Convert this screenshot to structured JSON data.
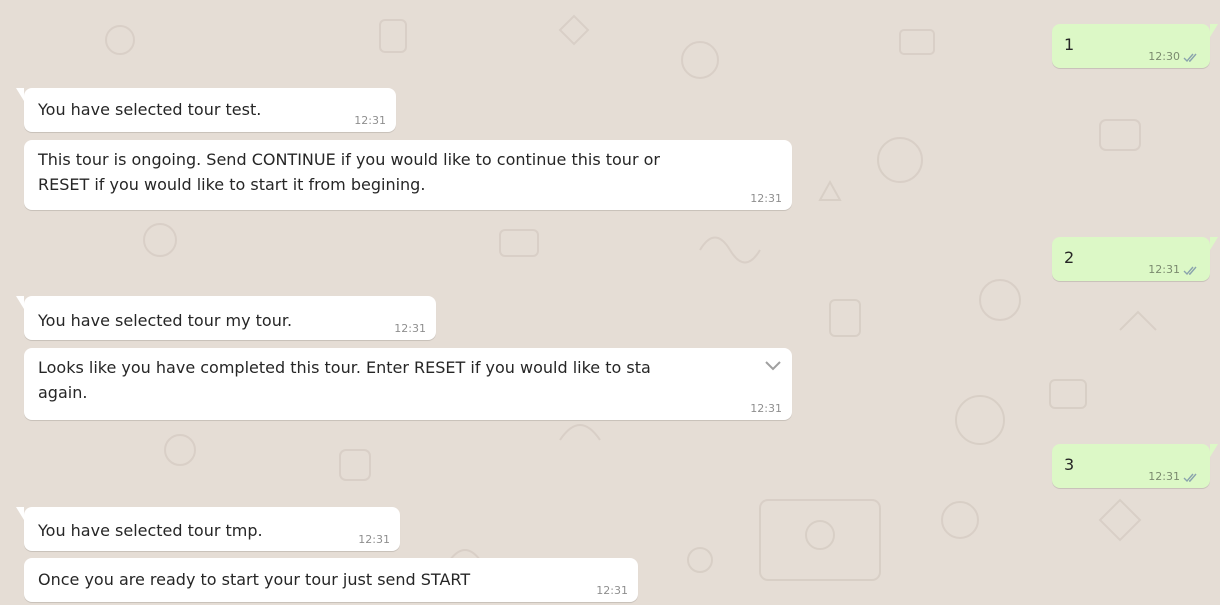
{
  "colors": {
    "background": "#e5ddd5",
    "incoming_bubble": "#ffffff",
    "outgoing_bubble": "#dcf8c6",
    "ticks": "#8aa3ad"
  },
  "messages": [
    {
      "direction": "outgoing",
      "text": "1",
      "time": "12:30",
      "status": "read"
    },
    {
      "direction": "incoming",
      "text": "You have selected tour test.",
      "time": "12:31"
    },
    {
      "direction": "incoming",
      "text": "This tour is ongoing. Send CONTINUE if you would like to continue this tour or\nRESET if you would like to start it from begining.",
      "time": "12:31"
    },
    {
      "direction": "outgoing",
      "text": "2",
      "time": "12:31",
      "status": "read"
    },
    {
      "direction": "incoming",
      "text": "You have selected tour my tour.",
      "time": "12:31"
    },
    {
      "direction": "incoming",
      "text": "Looks like you have completed this tour. Enter RESET if you would like to sta\nagain.",
      "time": "12:31",
      "menu_icon": "chevron-down-icon"
    },
    {
      "direction": "outgoing",
      "text": "3",
      "time": "12:31",
      "status": "read"
    },
    {
      "direction": "incoming",
      "text": "You have selected tour tmp.",
      "time": "12:31"
    },
    {
      "direction": "incoming",
      "text": "Once you are ready to start your tour just send START",
      "time": "12:31"
    }
  ]
}
